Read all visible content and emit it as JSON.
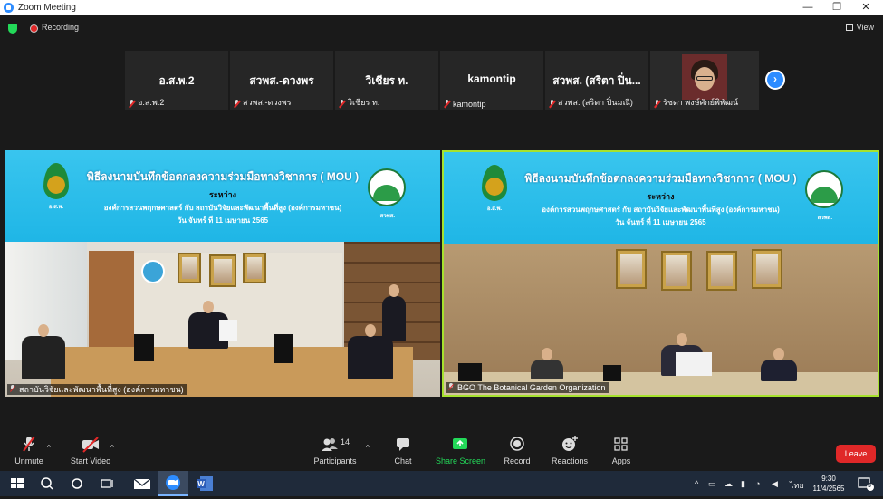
{
  "window": {
    "title": "Zoom Meeting",
    "minimize": "—",
    "restore": "❐",
    "close": "✕"
  },
  "meeting": {
    "recording_label": "Recording",
    "view_label": "View"
  },
  "participants_strip": [
    {
      "title": "อ.ส.พ.2",
      "label": "อ.ส.พ.2"
    },
    {
      "title": "สวพส.-ดวงพร",
      "label": "สวพส.-ดวงพร"
    },
    {
      "title": "วิเชียร ท.",
      "label": "วิเชียร ท."
    },
    {
      "title": "kamontip",
      "label": "kamontip"
    },
    {
      "title": "สวพส. (สริตา ปิ่น...",
      "label": "สวพส. (สริตา ปิ่นมณี)"
    },
    {
      "title": "",
      "label": "รัชดา พงษ์ศักย์พิพัฒน์"
    }
  ],
  "next_page_icon": "›",
  "banner": {
    "line1": "พิธีลงนามบันทึกข้อตกลงความร่วมมือทางวิชาการ ( MOU )",
    "line2": "ระหว่าง",
    "line3": "องค์การสวนพฤกษศาสตร์ กับ สถาบันวิจัยและพัฒนาพื้นที่สูง (องค์การมหาชน)",
    "line4": "วัน จันทร์ ที่ 11 เมษายน 2565",
    "logo_left_caption": "อ.ส.พ.",
    "logo_right_caption": "สวพส."
  },
  "videos": {
    "left_label": "สถาบันวิจัยและพัฒนาพื้นที่สูง (องค์การมหาชน)",
    "right_label": "BGO The Botanical Garden Organization"
  },
  "toolbar": {
    "unmute": "Unmute",
    "start_video": "Start Video",
    "participants": "Participants",
    "participants_count": "14",
    "chat": "Chat",
    "share_screen": "Share Screen",
    "record": "Record",
    "reactions": "Reactions",
    "apps": "Apps",
    "leave": "Leave"
  },
  "taskbar": {
    "time": "9:30",
    "date": "11/4/2565",
    "lang": "ไทย",
    "notif_count": "3"
  },
  "colors": {
    "accent": "#2d8cff",
    "share_green": "#23d959",
    "leave_red": "#e02828",
    "active_border": "#a6e22e"
  }
}
